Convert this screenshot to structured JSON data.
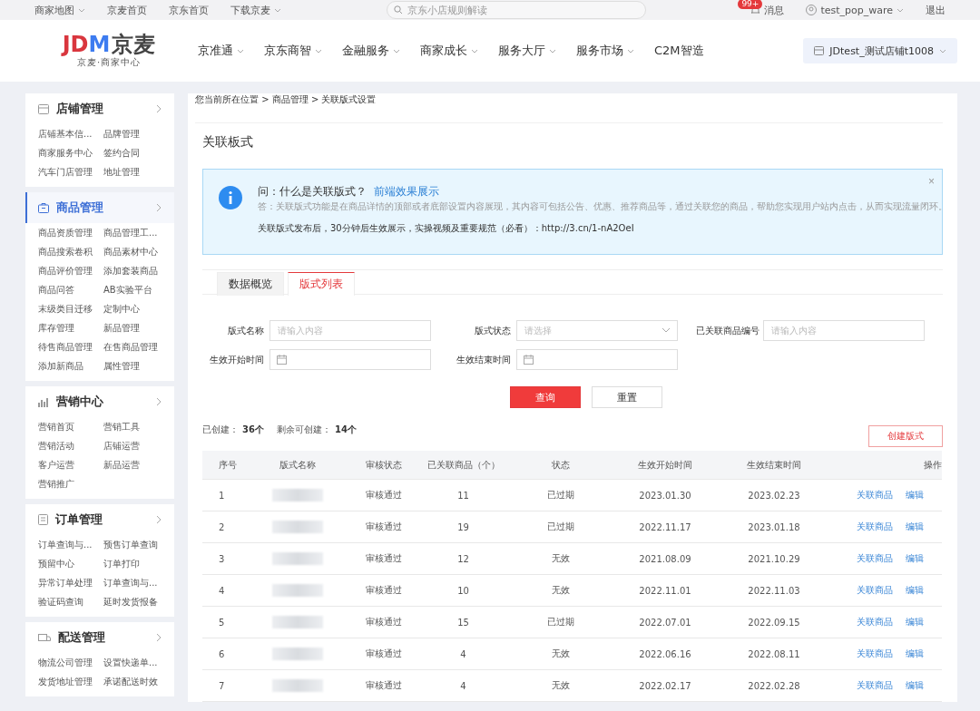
{
  "top_bar": {
    "links": [
      {
        "label": "商家地图",
        "caret": true
      },
      {
        "label": "京麦首页",
        "caret": false
      },
      {
        "label": "京东首页",
        "caret": false
      },
      {
        "label": "下载京麦",
        "caret": true
      }
    ],
    "search": {
      "placeholder": "京东小店规则解读"
    },
    "messages": {
      "badge": "99+",
      "label": "消息"
    },
    "user": {
      "name": "test_pop_ware"
    },
    "logout": "退出"
  },
  "header": {
    "logo": {
      "red": "JD",
      "blue": "M",
      "name": "京麦",
      "tagline": "京麦·商家中心"
    },
    "nav": [
      {
        "label": "京准通",
        "caret": true
      },
      {
        "label": "京东商智",
        "caret": true
      },
      {
        "label": "金融服务",
        "caret": true
      },
      {
        "label": "商家成长",
        "caret": true
      },
      {
        "label": "服务大厅",
        "caret": true
      },
      {
        "label": "服务市场",
        "caret": true
      },
      {
        "label": "C2M智造",
        "caret": false
      }
    ],
    "store": "JDtest_测试店铺t1008"
  },
  "sidebar": [
    {
      "kind": "store",
      "title": "店铺管理",
      "selected": false,
      "items": [
        "店铺基本信...",
        "品牌管理",
        "商家服务中心",
        "签约合同",
        "汽车门店管理",
        "地址管理"
      ]
    },
    {
      "kind": "goods",
      "title": "商品管理",
      "selected": true,
      "items": [
        "商品资质管理",
        "商品管理工...",
        "商品搜索卷积",
        "商品素材中心",
        "商品评价管理",
        "添加套装商品",
        "商品问答",
        "AB实验平台",
        "末级类目迁移",
        "定制中心",
        "库存管理",
        "新品管理",
        "待售商品管理",
        "在售商品管理",
        "添加新商品",
        "属性管理"
      ]
    },
    {
      "kind": "marketing",
      "title": "营销中心",
      "selected": false,
      "items": [
        "营销首页",
        "营销工具",
        "营销活动",
        "店铺运营",
        "客户运营",
        "新品运营",
        "营销推广"
      ]
    },
    {
      "kind": "order",
      "title": "订单管理",
      "selected": false,
      "items": [
        "订单查询与...",
        "预售订单查询",
        "预留中心",
        "订单打印",
        "异常订单处理",
        "订单查询与...",
        "验证码查询",
        "延时发货报备"
      ]
    },
    {
      "kind": "delivery",
      "title": "配送管理",
      "selected": false,
      "items": [
        "物流公司管理",
        "设置快递单...",
        "发货地址管理",
        "承诺配送时效"
      ]
    }
  ],
  "breadcrumb": "您当前所在位置 > 商品管理 > 关联版式设置",
  "page_title": "关联板式",
  "notice": {
    "question": "问：什么是关联版式？",
    "link": "前端效果展示",
    "answer": "答：关联版式功能是在商品详情的顶部或者底部设置内容展现，其内容可包括公告、优惠、推荐商品等，通过关联您的商品，帮助您实现用户站内点击，从而实现流量闭环。",
    "note": "关联版式发布后，30分钟后生效展示，实操视频及重要规范（必看）：http://3.cn/1-nA2OeI",
    "close": "×"
  },
  "tabs": [
    {
      "label": "数据概览",
      "selected": false
    },
    {
      "label": "版式列表",
      "selected": true
    }
  ],
  "filters": [
    {
      "kind": "text",
      "label": "版式名称",
      "placeholder": "请输入内容"
    },
    {
      "kind": "select",
      "label": "版式状态",
      "placeholder": "请选择"
    },
    {
      "kind": "text",
      "label": "已关联商品编号",
      "placeholder": "请输入内容"
    },
    {
      "kind": "date",
      "label": "生效开始时间"
    },
    {
      "kind": "date",
      "label": "生效结束时间"
    }
  ],
  "buttons": {
    "query": "查询",
    "reset": "重置",
    "create": "创建版式"
  },
  "counts": [
    {
      "label": "已创建：",
      "value": "36个"
    },
    {
      "label": "剩余可创建：",
      "value": "14个"
    }
  ],
  "table": {
    "columns": [
      "序号",
      "版式名称",
      "审核状态",
      "已关联商品（个）",
      "状态",
      "生效开始时间",
      "生效结束时间",
      "操作"
    ],
    "rows": [
      {
        "index": "1",
        "review": "审核通过",
        "linked": "11",
        "status": "已过期",
        "start": "2023.01.30",
        "end": "2023.02.23",
        "actions": [
          "关联商品",
          "编辑"
        ]
      },
      {
        "index": "2",
        "review": "审核通过",
        "linked": "19",
        "status": "已过期",
        "start": "2022.11.17",
        "end": "2023.01.18",
        "actions": [
          "关联商品",
          "编辑"
        ]
      },
      {
        "index": "3",
        "review": "审核通过",
        "linked": "12",
        "status": "无效",
        "start": "2021.08.09",
        "end": "2021.10.29",
        "actions": [
          "关联商品",
          "编辑"
        ]
      },
      {
        "index": "4",
        "review": "审核通过",
        "linked": "10",
        "status": "无效",
        "start": "2022.11.01",
        "end": "2022.11.03",
        "actions": [
          "关联商品",
          "编辑"
        ]
      },
      {
        "index": "5",
        "review": "审核通过",
        "linked": "15",
        "status": "已过期",
        "start": "2022.07.01",
        "end": "2022.09.15",
        "actions": [
          "关联商品",
          "编辑"
        ]
      },
      {
        "index": "6",
        "review": "审核通过",
        "linked": "4",
        "status": "无效",
        "start": "2022.06.16",
        "end": "2022.08.11",
        "actions": [
          "关联商品",
          "编辑"
        ]
      },
      {
        "index": "7",
        "review": "审核通过",
        "linked": "4",
        "status": "无效",
        "start": "2022.02.17",
        "end": "2022.02.28",
        "actions": [
          "关联商品",
          "编辑"
        ]
      }
    ]
  }
}
